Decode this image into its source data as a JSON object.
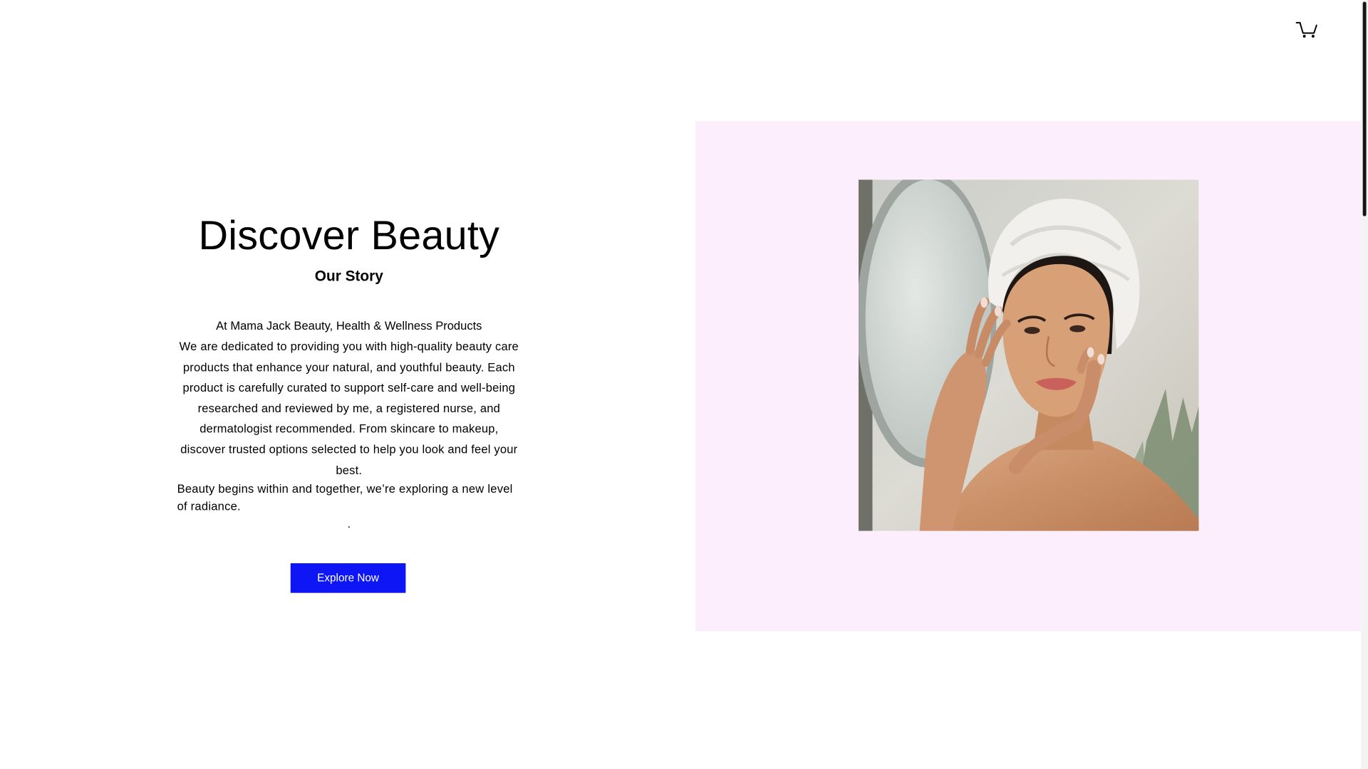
{
  "header": {
    "cart_icon": "shopping-cart-icon"
  },
  "hero": {
    "title": "Discover Beauty",
    "subtitle": "Our Story",
    "intro": "At Mama Jack Beauty, Health & Wellness Products",
    "body": "We are dedicated to providing you with high-quality beauty care products that enhance your natural, and youthful beauty. Each product is carefully curated to support self-care and well-being researched and reviewed by me, a registered nurse, and dermatologist recommended. From skincare to makeup, discover trusted options selected to help you look and feel your best.",
    "radiance": "Beauty begins within and together, we’re exploring a new level of radiance.",
    "dot": ".",
    "cta_label": "Explore Now"
  },
  "panel": {
    "background_color": "#fdeefd",
    "image_icon": "woman-skincare-photo"
  },
  "colors": {
    "cta_background": "#0e16f6",
    "text": "#000000",
    "page_background": "#ffffff",
    "scrollbar_thumb": "#141414"
  }
}
